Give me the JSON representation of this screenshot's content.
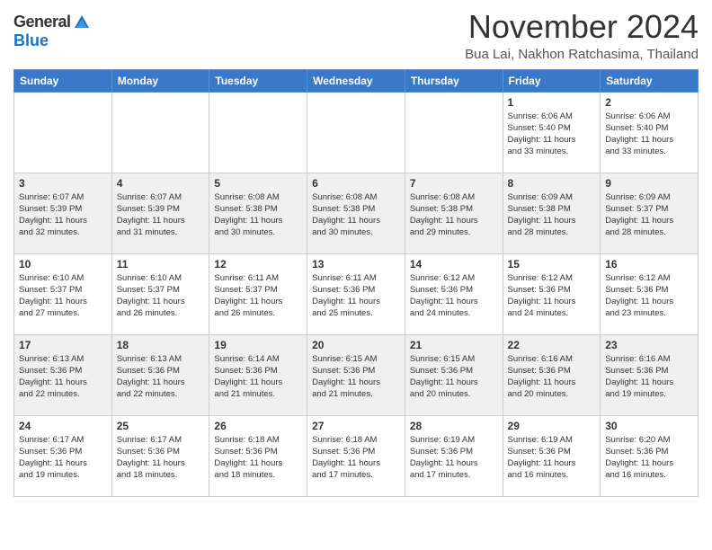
{
  "logo": {
    "general": "General",
    "blue": "Blue"
  },
  "title": "November 2024",
  "location": "Bua Lai, Nakhon Ratchasima, Thailand",
  "weekdays": [
    "Sunday",
    "Monday",
    "Tuesday",
    "Wednesday",
    "Thursday",
    "Friday",
    "Saturday"
  ],
  "weeks": [
    [
      {
        "day": "",
        "info": ""
      },
      {
        "day": "",
        "info": ""
      },
      {
        "day": "",
        "info": ""
      },
      {
        "day": "",
        "info": ""
      },
      {
        "day": "",
        "info": ""
      },
      {
        "day": "1",
        "info": "Sunrise: 6:06 AM\nSunset: 5:40 PM\nDaylight: 11 hours\nand 33 minutes."
      },
      {
        "day": "2",
        "info": "Sunrise: 6:06 AM\nSunset: 5:40 PM\nDaylight: 11 hours\nand 33 minutes."
      }
    ],
    [
      {
        "day": "3",
        "info": "Sunrise: 6:07 AM\nSunset: 5:39 PM\nDaylight: 11 hours\nand 32 minutes."
      },
      {
        "day": "4",
        "info": "Sunrise: 6:07 AM\nSunset: 5:39 PM\nDaylight: 11 hours\nand 31 minutes."
      },
      {
        "day": "5",
        "info": "Sunrise: 6:08 AM\nSunset: 5:38 PM\nDaylight: 11 hours\nand 30 minutes."
      },
      {
        "day": "6",
        "info": "Sunrise: 6:08 AM\nSunset: 5:38 PM\nDaylight: 11 hours\nand 30 minutes."
      },
      {
        "day": "7",
        "info": "Sunrise: 6:08 AM\nSunset: 5:38 PM\nDaylight: 11 hours\nand 29 minutes."
      },
      {
        "day": "8",
        "info": "Sunrise: 6:09 AM\nSunset: 5:38 PM\nDaylight: 11 hours\nand 28 minutes."
      },
      {
        "day": "9",
        "info": "Sunrise: 6:09 AM\nSunset: 5:37 PM\nDaylight: 11 hours\nand 28 minutes."
      }
    ],
    [
      {
        "day": "10",
        "info": "Sunrise: 6:10 AM\nSunset: 5:37 PM\nDaylight: 11 hours\nand 27 minutes."
      },
      {
        "day": "11",
        "info": "Sunrise: 6:10 AM\nSunset: 5:37 PM\nDaylight: 11 hours\nand 26 minutes."
      },
      {
        "day": "12",
        "info": "Sunrise: 6:11 AM\nSunset: 5:37 PM\nDaylight: 11 hours\nand 26 minutes."
      },
      {
        "day": "13",
        "info": "Sunrise: 6:11 AM\nSunset: 5:36 PM\nDaylight: 11 hours\nand 25 minutes."
      },
      {
        "day": "14",
        "info": "Sunrise: 6:12 AM\nSunset: 5:36 PM\nDaylight: 11 hours\nand 24 minutes."
      },
      {
        "day": "15",
        "info": "Sunrise: 6:12 AM\nSunset: 5:36 PM\nDaylight: 11 hours\nand 24 minutes."
      },
      {
        "day": "16",
        "info": "Sunrise: 6:12 AM\nSunset: 5:36 PM\nDaylight: 11 hours\nand 23 minutes."
      }
    ],
    [
      {
        "day": "17",
        "info": "Sunrise: 6:13 AM\nSunset: 5:36 PM\nDaylight: 11 hours\nand 22 minutes."
      },
      {
        "day": "18",
        "info": "Sunrise: 6:13 AM\nSunset: 5:36 PM\nDaylight: 11 hours\nand 22 minutes."
      },
      {
        "day": "19",
        "info": "Sunrise: 6:14 AM\nSunset: 5:36 PM\nDaylight: 11 hours\nand 21 minutes."
      },
      {
        "day": "20",
        "info": "Sunrise: 6:15 AM\nSunset: 5:36 PM\nDaylight: 11 hours\nand 21 minutes."
      },
      {
        "day": "21",
        "info": "Sunrise: 6:15 AM\nSunset: 5:36 PM\nDaylight: 11 hours\nand 20 minutes."
      },
      {
        "day": "22",
        "info": "Sunrise: 6:16 AM\nSunset: 5:36 PM\nDaylight: 11 hours\nand 20 minutes."
      },
      {
        "day": "23",
        "info": "Sunrise: 6:16 AM\nSunset: 5:36 PM\nDaylight: 11 hours\nand 19 minutes."
      }
    ],
    [
      {
        "day": "24",
        "info": "Sunrise: 6:17 AM\nSunset: 5:36 PM\nDaylight: 11 hours\nand 19 minutes."
      },
      {
        "day": "25",
        "info": "Sunrise: 6:17 AM\nSunset: 5:36 PM\nDaylight: 11 hours\nand 18 minutes."
      },
      {
        "day": "26",
        "info": "Sunrise: 6:18 AM\nSunset: 5:36 PM\nDaylight: 11 hours\nand 18 minutes."
      },
      {
        "day": "27",
        "info": "Sunrise: 6:18 AM\nSunset: 5:36 PM\nDaylight: 11 hours\nand 17 minutes."
      },
      {
        "day": "28",
        "info": "Sunrise: 6:19 AM\nSunset: 5:36 PM\nDaylight: 11 hours\nand 17 minutes."
      },
      {
        "day": "29",
        "info": "Sunrise: 6:19 AM\nSunset: 5:36 PM\nDaylight: 11 hours\nand 16 minutes."
      },
      {
        "day": "30",
        "info": "Sunrise: 6:20 AM\nSunset: 5:36 PM\nDaylight: 11 hours\nand 16 minutes."
      }
    ]
  ]
}
